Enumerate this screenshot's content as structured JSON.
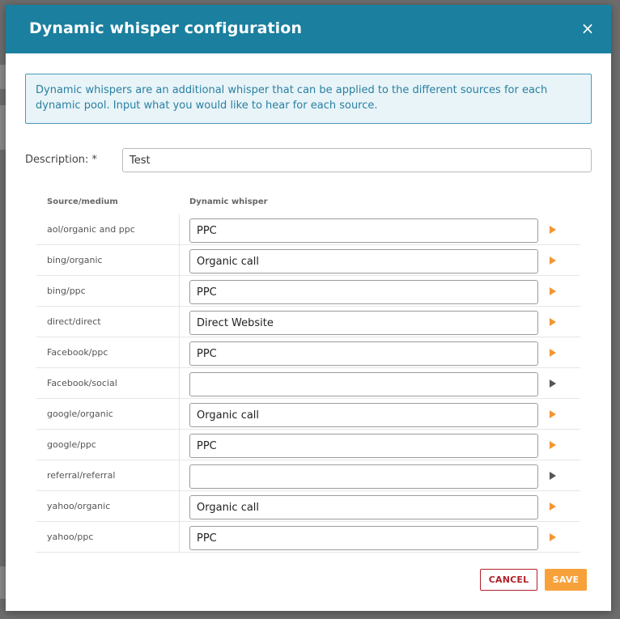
{
  "modal": {
    "title": "Dynamic whisper configuration",
    "close_symbol": "×",
    "info_text": "Dynamic whispers are an additional whisper that can be applied to the different sources for each dynamic pool. Input what you would like to hear for each source.",
    "description_label": "Description: *",
    "description_value": "Test"
  },
  "table": {
    "headers": {
      "source": "Source/medium",
      "whisper": "Dynamic whisper"
    },
    "rows": [
      {
        "source": "aol/organic and ppc",
        "whisper": "PPC",
        "play_icon": "play-icon",
        "active": true
      },
      {
        "source": "bing/organic",
        "whisper": "Organic call",
        "play_icon": "play-icon",
        "active": true
      },
      {
        "source": "bing/ppc",
        "whisper": "PPC",
        "play_icon": "play-icon",
        "active": true
      },
      {
        "source": "direct/direct",
        "whisper": "Direct Website",
        "play_icon": "play-icon",
        "active": true
      },
      {
        "source": "Facebook/ppc",
        "whisper": "PPC",
        "play_icon": "play-icon",
        "active": true
      },
      {
        "source": "Facebook/social",
        "whisper": "",
        "play_icon": "play-icon",
        "active": false
      },
      {
        "source": "google/organic",
        "whisper": "Organic call",
        "play_icon": "play-icon",
        "active": true
      },
      {
        "source": "google/ppc",
        "whisper": "PPC",
        "play_icon": "play-icon",
        "active": true
      },
      {
        "source": "referral/referral",
        "whisper": "",
        "play_icon": "play-icon",
        "active": false
      },
      {
        "source": "yahoo/organic",
        "whisper": "Organic call",
        "play_icon": "play-icon",
        "active": true
      },
      {
        "source": "yahoo/ppc",
        "whisper": "PPC",
        "play_icon": "play-icon",
        "active": true
      }
    ]
  },
  "buttons": {
    "cancel": "CANCEL",
    "save": "SAVE"
  },
  "colors": {
    "header": "#1b7f9f",
    "info_bg": "#e8f4f8",
    "accent_orange": "#f39632",
    "cancel_red": "#b21f2a",
    "save_orange": "#f7a13b"
  }
}
